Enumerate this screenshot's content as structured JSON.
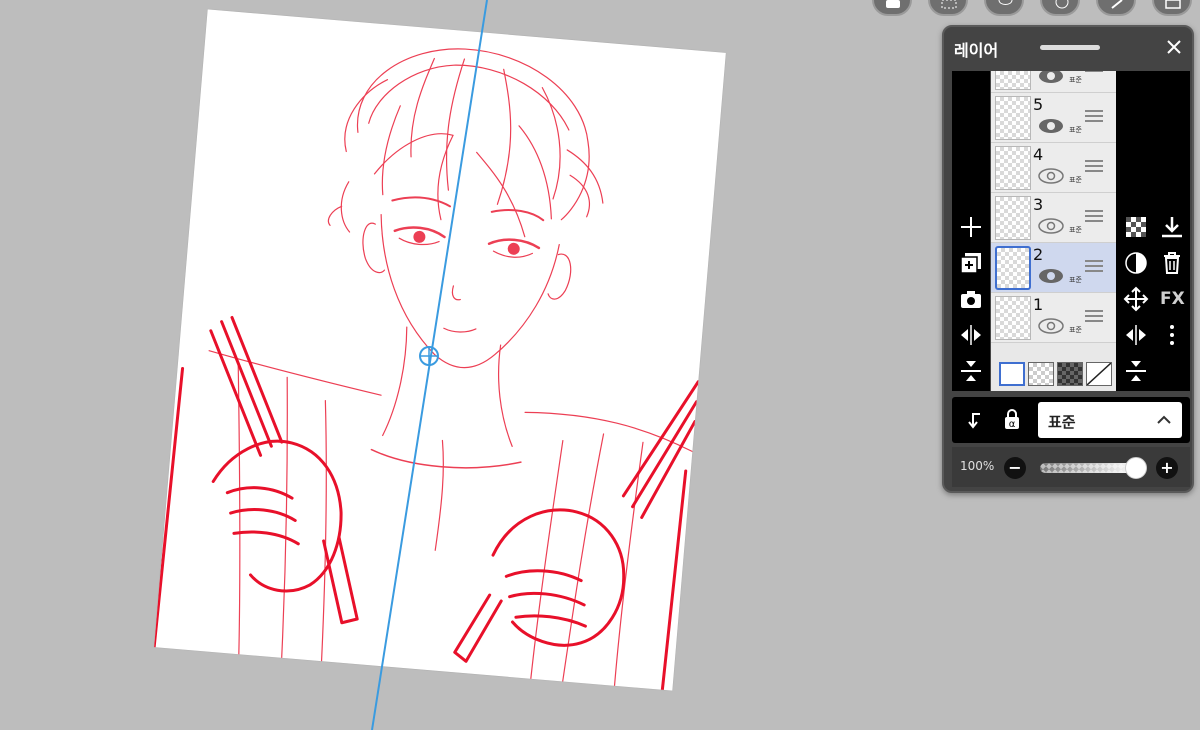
{
  "layer_panel": {
    "title": "레이어",
    "layers": [
      {
        "number": "5",
        "visible": true,
        "blend": "표준",
        "selected": false
      },
      {
        "number": "4",
        "visible": false,
        "blend": "표준",
        "selected": false
      },
      {
        "number": "3",
        "visible": false,
        "blend": "표준",
        "selected": false
      },
      {
        "number": "2",
        "visible": true,
        "blend": "표준",
        "selected": true
      },
      {
        "number": "1",
        "visible": false,
        "blend": "표준",
        "selected": false
      }
    ],
    "partial_top_layer_blend": "표준",
    "fx_label": "FX",
    "blend_mode": "표준",
    "opacity": "100%",
    "opacity_value": 1.0
  },
  "colors": {
    "background": "#bdbdbd",
    "sketch_red": "#e8102a",
    "symmetry_ruler": "#3a9be0",
    "panel_bg": "#444444",
    "selected_layer": "#cfd8ee"
  },
  "icons": {
    "top_toolbar": [
      "selection-tool-icon",
      "marquee-icon",
      "lasso-icon",
      "filter-icon",
      "pen-icon",
      "layer-view-icon"
    ],
    "left_column": [
      "add-layer-icon",
      "duplicate-layer-icon",
      "camera-icon",
      "flip-horizontal-icon",
      "merge-down-icon"
    ],
    "right_column_a": [
      "transparency-icon",
      "clipping-icon",
      "move-icon",
      "flip-icon",
      "merge-icon"
    ],
    "right_column_b": [
      "download-icon",
      "trash-icon",
      "fx-icon",
      "more-options-icon"
    ]
  }
}
